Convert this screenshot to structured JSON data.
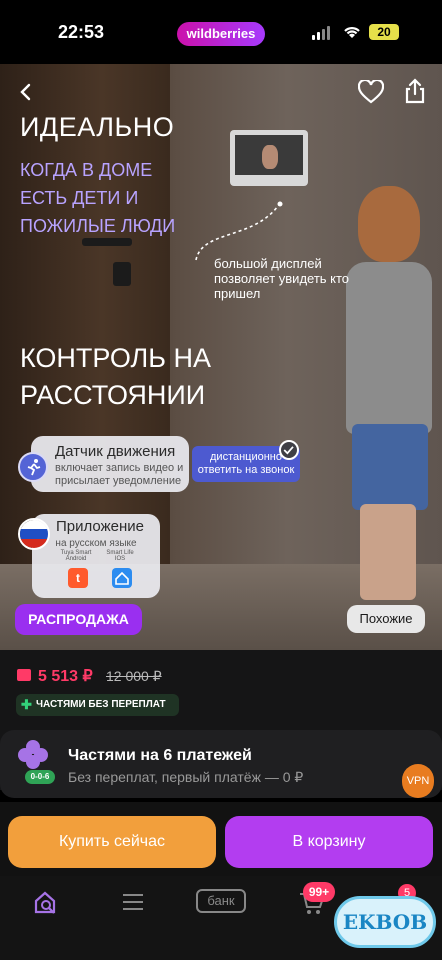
{
  "status_bar": {
    "time": "22:53",
    "app_pill": "wildberries",
    "battery": "20"
  },
  "hero": {
    "title1": "ИДЕАЛЬНО",
    "subtitle1": "КОГДА В ДОМЕ ЕСТЬ ДЕТИ И ПОЖИЛЫЕ ЛЮДИ",
    "display_note": "большой дисплей позволяет увидеть кто пришел",
    "title2": "КОНТРОЛЬ НА РАССТОЯНИИ",
    "motion_title": "Датчик движения",
    "motion_desc": "включает запись видео и присылает уведомление",
    "remote_note": "дистанционно ответить на звонок",
    "app_title": "Приложение",
    "app_lang": "на русском языке",
    "store1_name": "Tuya Smart",
    "store1_os": "Android",
    "store2_name": "Smart Life",
    "store2_os": "IOS",
    "sale_badge": "РАСПРОДАЖА",
    "similar_button": "Похожие"
  },
  "price": {
    "current": "5 513 ₽",
    "old": "12 000 ₽",
    "installment_chip": "ЧАСТЯМИ БЕЗ ПЕРЕПЛАТ"
  },
  "split": {
    "title": "Частями на 6 платежей",
    "subtitle": "Без переплат, первый платёж — 0 ₽",
    "badge": "0-0-6",
    "vpn": "VPN"
  },
  "actions": {
    "buy_now": "Купить сейчас",
    "to_cart": "В корзину"
  },
  "nav": {
    "bank": "банк",
    "cart_badge": "99+",
    "profile_badge": "5",
    "watermark": "EKBOB"
  },
  "colors": {
    "brand": "#b33df0",
    "price": "#ff3a67",
    "buy_now": "#f29f3c"
  }
}
